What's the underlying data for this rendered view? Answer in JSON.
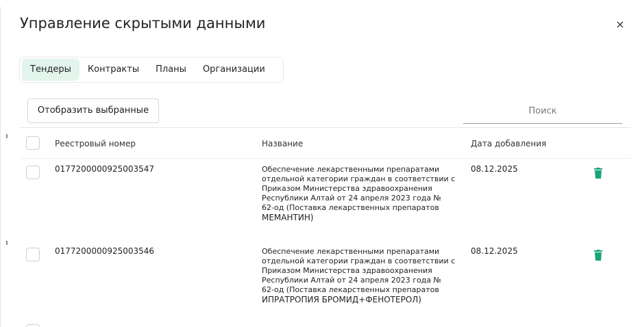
{
  "dialog": {
    "title": "Управление скрытыми данными",
    "close_glyph": "×"
  },
  "tabs": [
    {
      "label": "Тендеры",
      "active": true
    },
    {
      "label": "Контракты",
      "active": false
    },
    {
      "label": "Планы",
      "active": false
    },
    {
      "label": "Организации",
      "active": false
    }
  ],
  "toolbar": {
    "show_selected_label": "Отобразить выбранные",
    "search_placeholder": "Поиск"
  },
  "table": {
    "columns": {
      "number": "Реестровый номер",
      "name": "Название",
      "date": "Дата добавления"
    },
    "rows": [
      {
        "number": "0177200000925003547",
        "name_lines": [
          "Обеспечение лекарственными препаратами",
          "отдельной категории граждан в соответствии с",
          "Приказом Министерства здравоохранения",
          "Республики Алтай от 24 апреля 2023 года №",
          "62-од (Поставка лекарственных препаратов",
          "МЕМАНТИН)"
        ],
        "date": "08.12.2025"
      },
      {
        "number": "0177200000925003546",
        "name_lines": [
          "Обеспечение лекарственными препаратами",
          "отдельной категории граждан в соответствии с",
          "Приказом Министерства здравоохранения",
          "Республики Алтай от 24 апреля 2023 года №",
          "62-од (Поставка лекарственных препаратов",
          "ИПРАТРОПИЯ БРОМИД+ФЕНОТЕРОЛ)"
        ],
        "date": "08.12.2025"
      }
    ]
  },
  "icons": {
    "close": "close-icon",
    "delete": "trash-icon"
  },
  "colors": {
    "active_tab_bg": "#e3f4ec",
    "delete_icon": "#1aa37a"
  }
}
